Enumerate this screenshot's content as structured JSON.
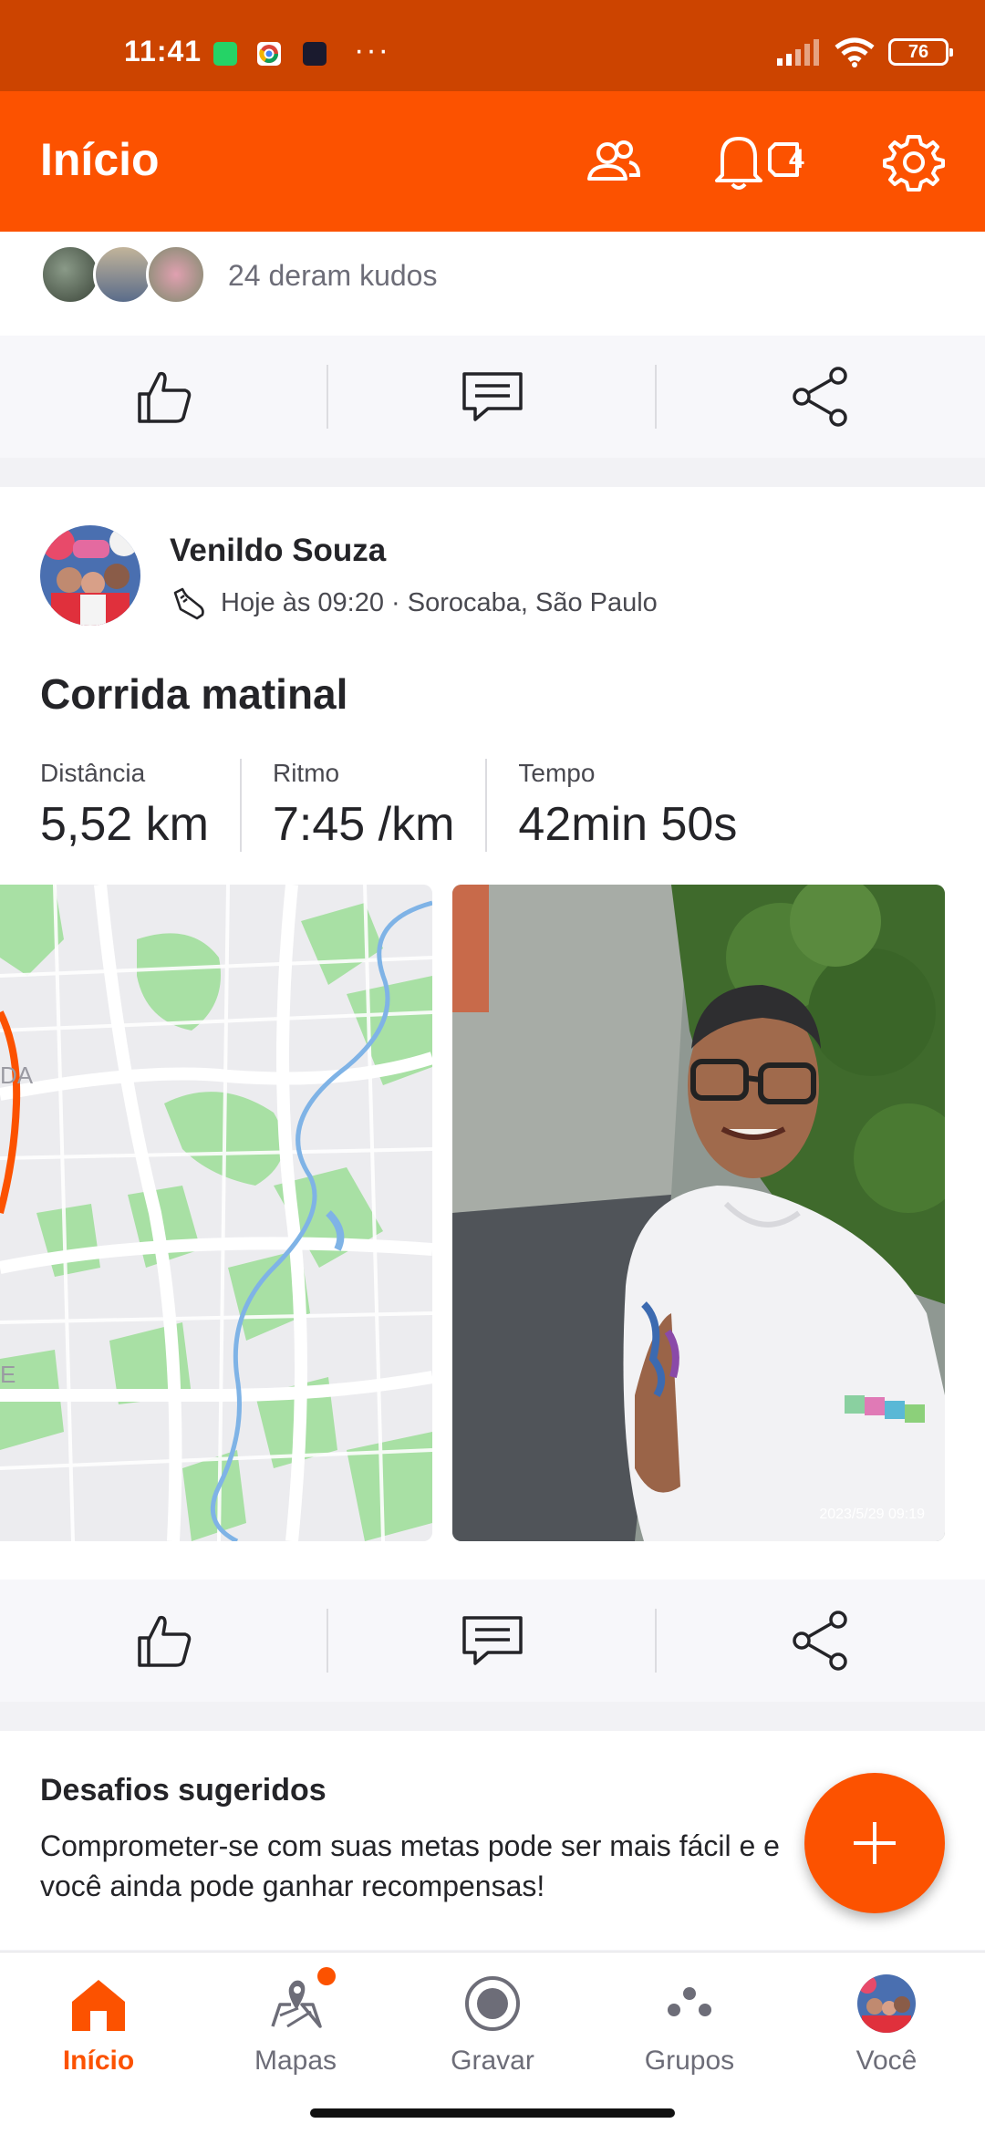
{
  "status_bar": {
    "time": "11:41",
    "battery": "76",
    "more": "···"
  },
  "app_bar": {
    "title": "Início",
    "notification_count": "4"
  },
  "kudos": {
    "text": "24 deram kudos"
  },
  "activity": {
    "user_name": "Venildo Souza",
    "meta": "Hoje às 09:20 · Sorocaba, São Paulo",
    "title": "Corrida matinal",
    "stats": [
      {
        "label": "Distância",
        "value": "5,52 km"
      },
      {
        "label": "Ritmo",
        "value": "7:45 /km"
      },
      {
        "label": "Tempo",
        "value": "42min 50s"
      }
    ],
    "photo_timestamp": "2023/5/29 09:19",
    "map_label": "DA",
    "map_label_2": "E"
  },
  "challenges": {
    "title": "Desafios sugeridos",
    "description": "Comprometer-se com suas metas pode ser mais fácil e e você ainda pode ganhar recompensas!"
  },
  "bottom_nav": [
    {
      "label": "Início",
      "icon": "home-icon",
      "active": true
    },
    {
      "label": "Mapas",
      "icon": "map-icon",
      "badge": true
    },
    {
      "label": "Gravar",
      "icon": "record-icon"
    },
    {
      "label": "Grupos",
      "icon": "groups-icon"
    },
    {
      "label": "Você",
      "icon": "avatar-icon"
    }
  ],
  "colors": {
    "brand": "#fc5200",
    "status_bar": "#cc4400"
  }
}
